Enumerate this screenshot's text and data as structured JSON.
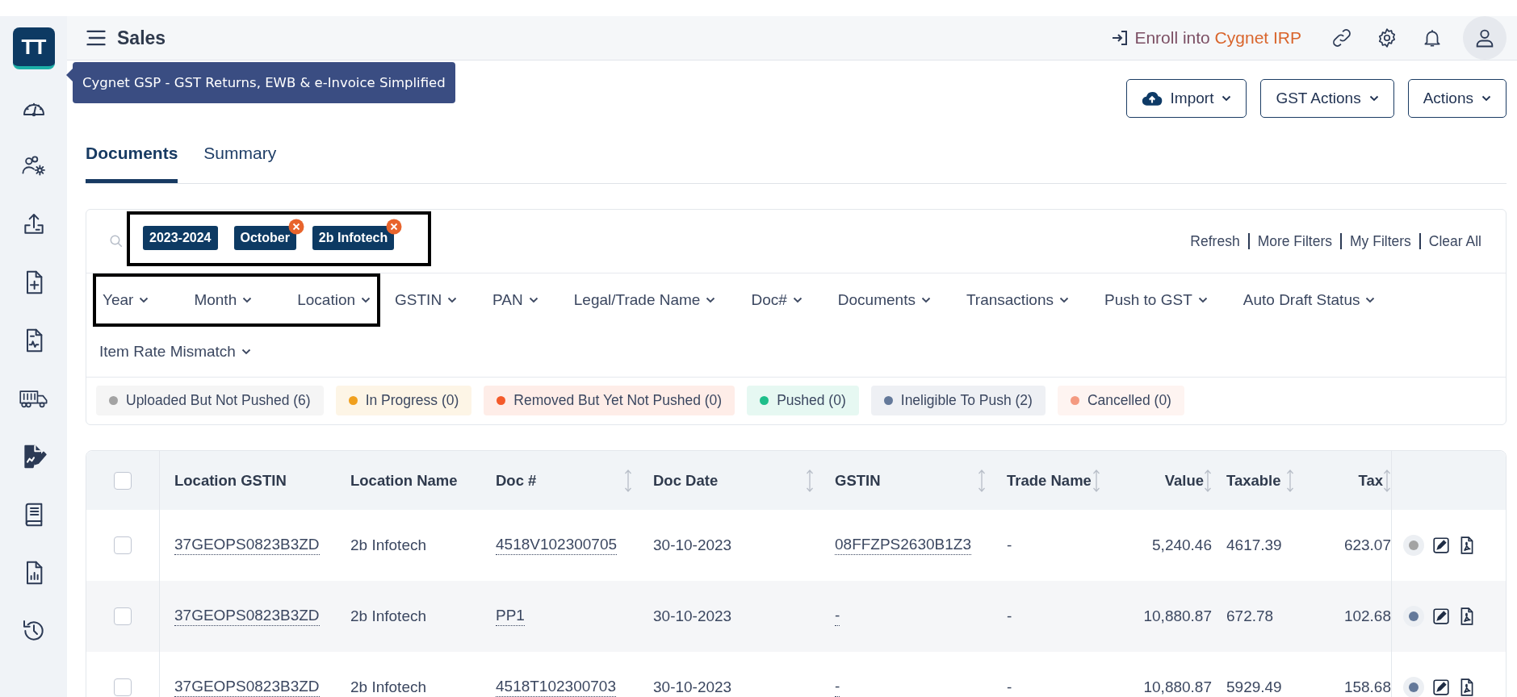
{
  "logo": {
    "text": "TT"
  },
  "tooltip": "Cygnet GSP - GST Returns, EWB & e-Invoice Simplified",
  "header": {
    "title": "Sales",
    "enroll_prefix": "Enroll into",
    "enroll_brand": "Cygnet IRP"
  },
  "actions": [
    {
      "label": "Import",
      "kind": "upload"
    },
    {
      "label": "GST Actions",
      "kind": "plain"
    },
    {
      "label": "Actions",
      "kind": "plain"
    }
  ],
  "tabs": [
    {
      "label": "Documents",
      "selected": true
    },
    {
      "label": "Summary",
      "selected": false
    }
  ],
  "chips": {
    "highlighted": true,
    "items": [
      {
        "label": "2023-2024",
        "removable": false
      },
      {
        "label": "October",
        "removable": true
      },
      {
        "label": "2b Infotech",
        "removable": true
      }
    ]
  },
  "links": [
    "Refresh",
    "More Filters",
    "My Filters",
    "Clear All"
  ],
  "filters": [
    {
      "label": "Year",
      "highlighted": true
    },
    {
      "label": "Month",
      "highlighted": true
    },
    {
      "label": "Location",
      "highlighted": true
    },
    {
      "label": "GSTIN",
      "highlighted": false
    },
    {
      "label": "PAN",
      "highlighted": false
    },
    {
      "label": "Legal/Trade Name",
      "highlighted": false
    },
    {
      "label": "Doc#",
      "highlighted": false
    },
    {
      "label": "Documents",
      "highlighted": false
    },
    {
      "label": "Transactions",
      "highlighted": false
    },
    {
      "label": "Push to GST",
      "highlighted": false
    },
    {
      "label": "Auto Draft Status",
      "highlighted": false
    },
    {
      "label": "Item Rate Mismatch",
      "highlighted": false
    }
  ],
  "statuses": [
    {
      "label": "Uploaded But Not Pushed (6)",
      "color": "#a3a3a3"
    },
    {
      "label": "In Progress (0)",
      "color": "#f0a01e"
    },
    {
      "label": "Removed But Yet Not Pushed (0)",
      "color": "#f45a2a"
    },
    {
      "label": "Pushed (0)",
      "color": "#1ebe8a"
    },
    {
      "label": "Ineligible To Push (2)",
      "color": "#64799a"
    },
    {
      "label": "Cancelled (0)",
      "color": "#f49a80"
    }
  ],
  "table": {
    "all_checked": false,
    "columns": [
      {
        "label": "Location GSTIN",
        "sortable": false,
        "numeric": false,
        "link": true
      },
      {
        "label": "Location Name",
        "sortable": false,
        "numeric": false,
        "link": false
      },
      {
        "label": "Doc #",
        "sortable": true,
        "numeric": false,
        "link": true
      },
      {
        "label": "Doc Date",
        "sortable": true,
        "numeric": false,
        "link": false
      },
      {
        "label": "GSTIN",
        "sortable": true,
        "numeric": false,
        "link": true
      },
      {
        "label": "Trade Name",
        "sortable": true,
        "numeric": false,
        "link": false
      },
      {
        "label": "Value",
        "sortable": true,
        "numeric": true,
        "link": false
      },
      {
        "label": "Taxable",
        "sortable": true,
        "numeric": false,
        "link": false
      },
      {
        "label": "Tax",
        "sortable": true,
        "numeric": true,
        "link": false
      }
    ],
    "rows": [
      {
        "checked": false,
        "color": "#a3a3a3",
        "cells": [
          "37GEOPS0823B3ZD",
          "2b Infotech",
          "4518V102300705",
          "30-10-2023",
          "08FFZPS2630B1Z3",
          "-",
          "5,240.46",
          "4617.39",
          "623.07"
        ]
      },
      {
        "checked": false,
        "color": "#64799a",
        "cells": [
          "37GEOPS0823B3ZD",
          "2b Infotech",
          "PP1",
          "30-10-2023",
          "-",
          "-",
          "10,880.87",
          "672.78",
          "102.68"
        ]
      },
      {
        "checked": false,
        "color": "#64799a",
        "cells": [
          "37GEOPS0823B3ZD",
          "2b Infotech",
          "4518T102300703",
          "30-10-2023",
          "-",
          "-",
          "10,880.87",
          "5929.49",
          "158.68"
        ]
      }
    ]
  }
}
